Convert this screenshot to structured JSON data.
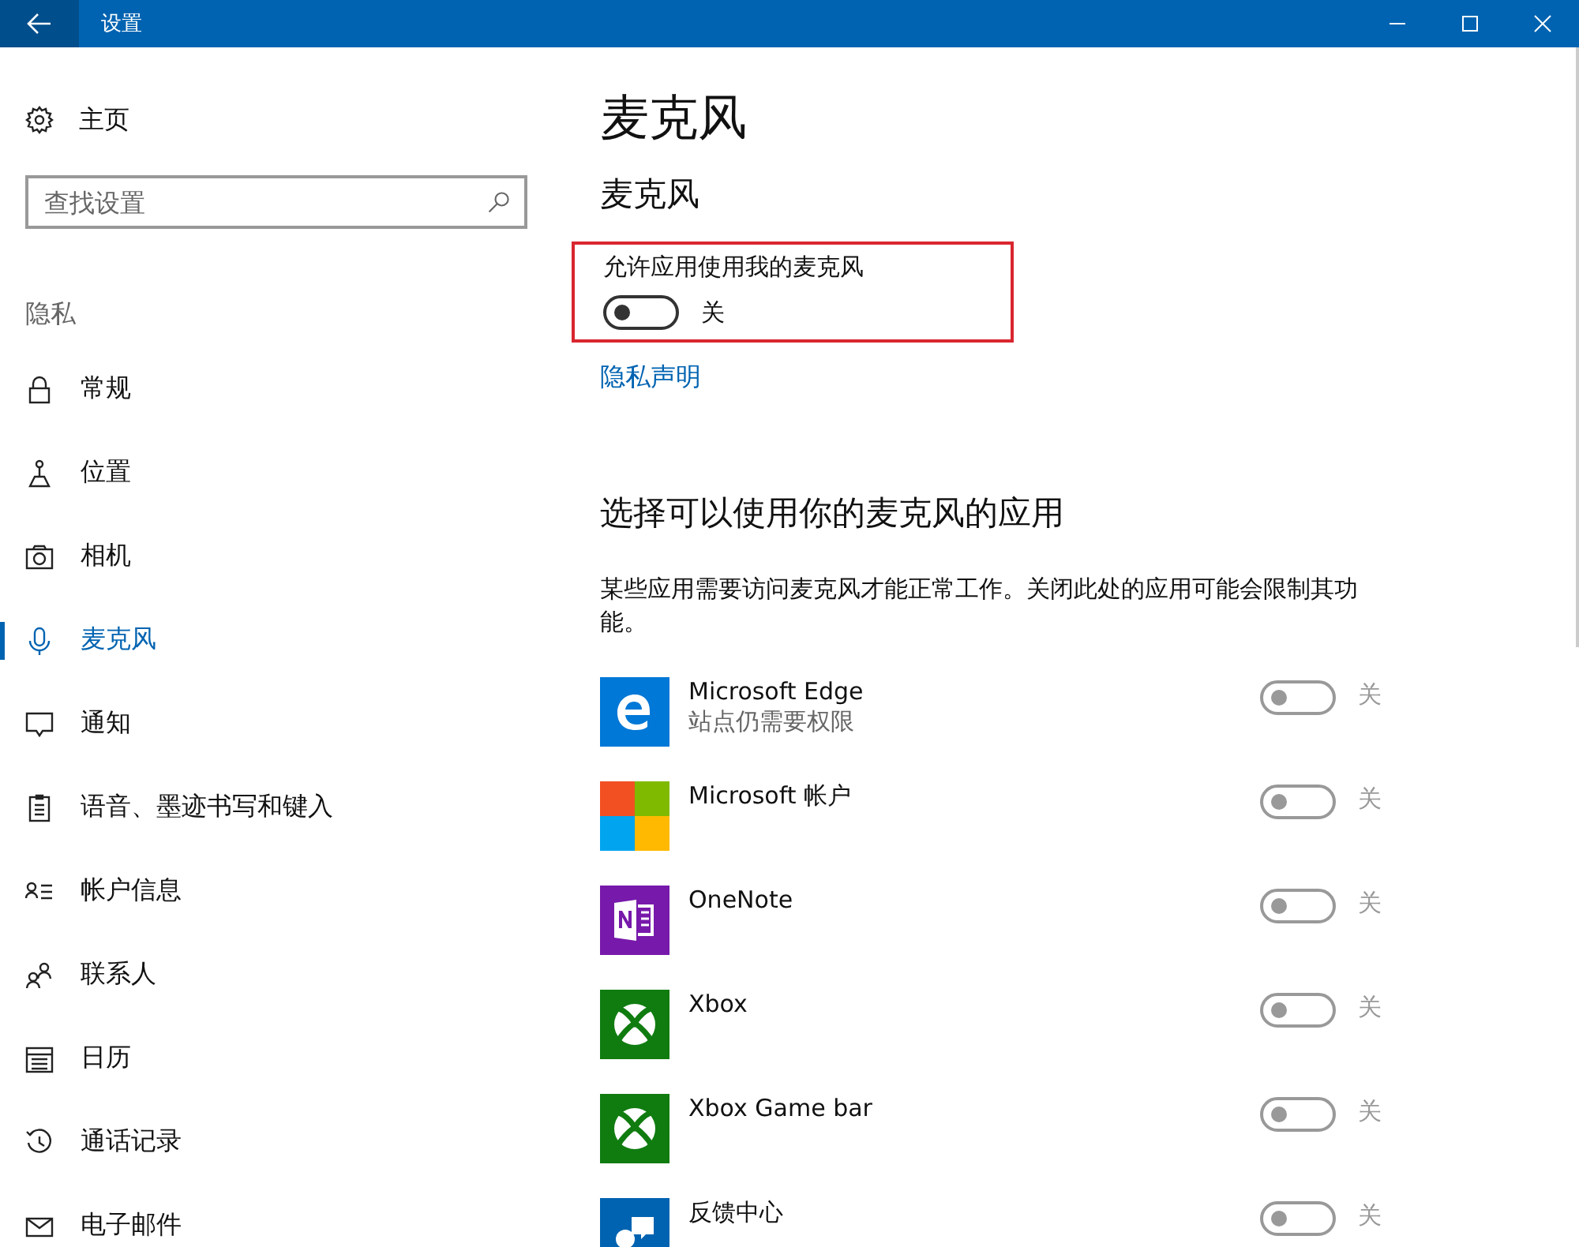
{
  "window": {
    "title": "设置"
  },
  "sidebar": {
    "home": "主页",
    "search": {
      "placeholder": "查找设置"
    },
    "section": "隐私",
    "items": [
      {
        "label": "常规",
        "selected": false
      },
      {
        "label": "位置",
        "selected": false
      },
      {
        "label": "相机",
        "selected": false
      },
      {
        "label": "麦克风",
        "selected": true
      },
      {
        "label": "通知",
        "selected": false
      },
      {
        "label": "语音、墨迹书写和键入",
        "selected": false
      },
      {
        "label": "帐户信息",
        "selected": false
      },
      {
        "label": "联系人",
        "selected": false
      },
      {
        "label": "日历",
        "selected": false
      },
      {
        "label": "通话记录",
        "selected": false
      },
      {
        "label": "电子邮件",
        "selected": false
      }
    ]
  },
  "main": {
    "title": "麦克风",
    "subtitle": "麦克风",
    "master": {
      "label": "允许应用使用我的麦克风",
      "on": false,
      "state_text": "关",
      "highlighted": true
    },
    "privacy_link": "隐私声明",
    "apps_heading": "选择可以使用你的麦克风的应用",
    "apps_description": "某些应用需要访问麦克风才能正常工作。关闭此处的应用可能会限制其功能。",
    "apps": [
      {
        "name": "Microsoft Edge",
        "detail": "站点仍需要权限",
        "on": false,
        "disabled": true,
        "state_text": "关"
      },
      {
        "name": "Microsoft 帐户",
        "on": false,
        "disabled": true,
        "state_text": "关"
      },
      {
        "name": "OneNote",
        "on": false,
        "disabled": true,
        "state_text": "关"
      },
      {
        "name": "Xbox",
        "on": false,
        "disabled": true,
        "state_text": "关"
      },
      {
        "name": "Xbox Game bar",
        "on": false,
        "disabled": true,
        "state_text": "关"
      },
      {
        "name": "反馈中心",
        "on": false,
        "disabled": true,
        "state_text": "关"
      }
    ]
  }
}
